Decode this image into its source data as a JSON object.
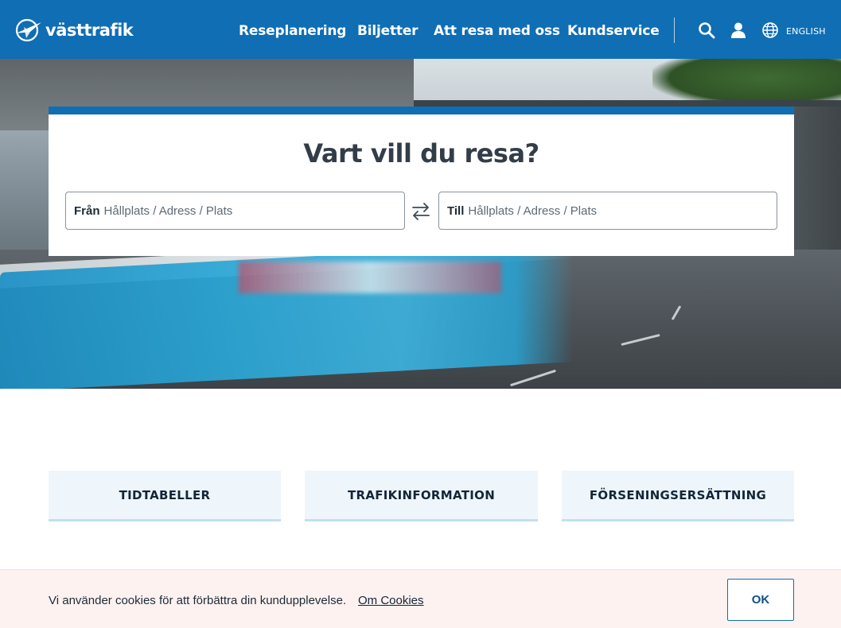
{
  "header": {
    "logo_text": "västtrafik",
    "nav": [
      {
        "label": "Reseplanering"
      },
      {
        "label": "Biljetter"
      },
      {
        "label": "Att resa med oss"
      },
      {
        "label": "Kundservice"
      }
    ],
    "language_label": "ENGLISH",
    "icons": [
      "search-icon",
      "user-icon",
      "globe-icon"
    ]
  },
  "search": {
    "title": "Vart vill du resa?",
    "from_label": "Från",
    "from_placeholder": "Hållplats / Adress / Plats",
    "from_value": "",
    "to_label": "Till",
    "to_placeholder": "Hållplats / Adress / Plats",
    "to_value": "",
    "swap_icon": "swap-arrows-icon"
  },
  "shortcuts": [
    {
      "label": "TIDTABELLER"
    },
    {
      "label": "TRAFIKINFORMATION"
    },
    {
      "label": "FÖRSENINGSERSÄTTNING"
    }
  ],
  "cookie": {
    "text": "Vi använder cookies för att förbättra din kundupplevelse.",
    "link": "Om Cookies",
    "ok_label": "OK"
  },
  "colors": {
    "brand_blue": "#0f6eb4",
    "tile_bg": "#eef6fc",
    "cookie_bg": "#fdf2f0"
  }
}
